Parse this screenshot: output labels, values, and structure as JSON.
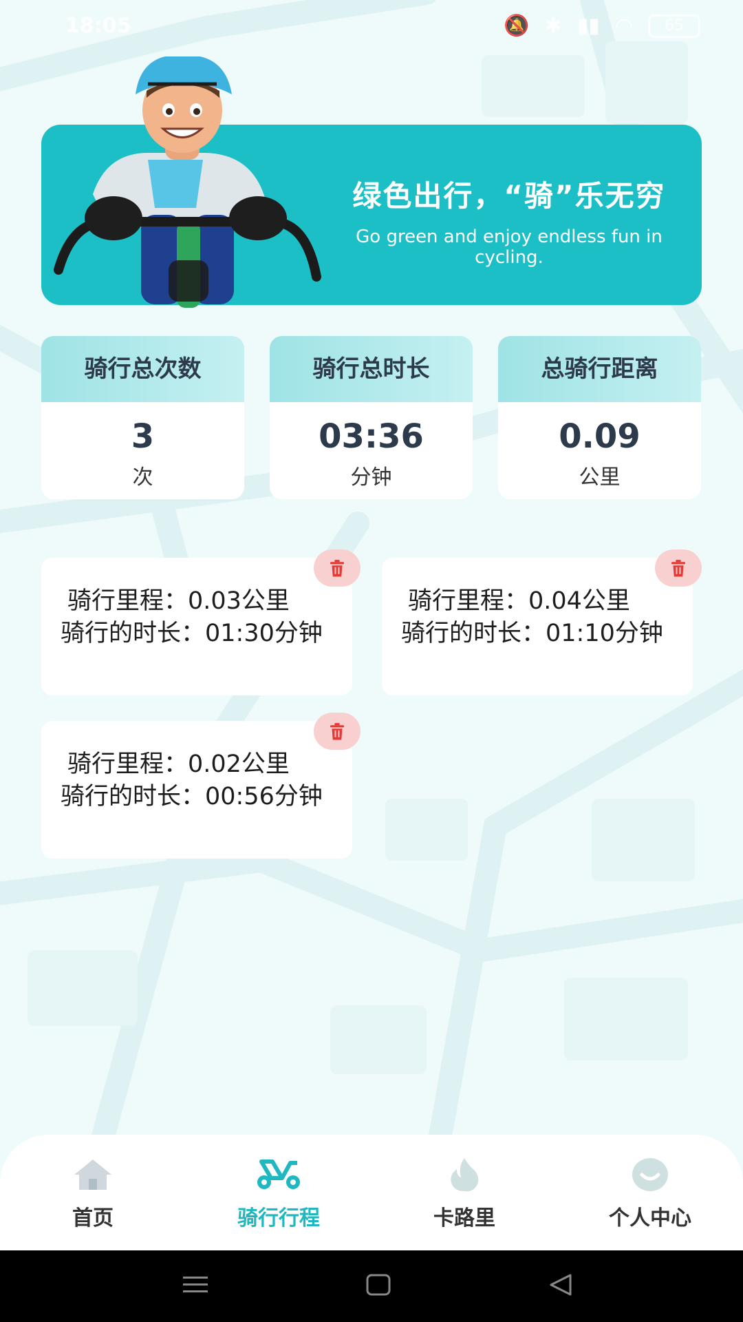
{
  "status_bar": {
    "time": "18:05",
    "battery": "65"
  },
  "banner": {
    "title": "绿色出行，“骑”乐无穷",
    "subtitle": "Go green and enjoy endless fun in cycling."
  },
  "stats": [
    {
      "label": "骑行总次数",
      "value": "3",
      "unit": "次"
    },
    {
      "label": "骑行总时长",
      "value": "03:36",
      "unit": "分钟"
    },
    {
      "label": "总骑行距离",
      "value": "0.09",
      "unit": "公里"
    }
  ],
  "records": [
    {
      "distance": "骑行里程：0.03公里",
      "duration": "骑行的时长：01:30分钟"
    },
    {
      "distance": "骑行里程：0.04公里",
      "duration": "骑行的时长：01:10分钟"
    },
    {
      "distance": "骑行里程：0.02公里",
      "duration": "骑行的时长：00:56分钟"
    }
  ],
  "nav": {
    "home": "首页",
    "rides": "骑行行程",
    "calories": "卡路里",
    "profile": "个人中心"
  },
  "colors": {
    "accent": "#1fb8c0",
    "banner": "#1dbfc6",
    "delete_bg": "#f9d0d0",
    "delete_icon": "#e53935"
  },
  "icons": [
    "home-icon",
    "bike-icon",
    "flame-icon",
    "smile-icon",
    "trash-icon"
  ]
}
